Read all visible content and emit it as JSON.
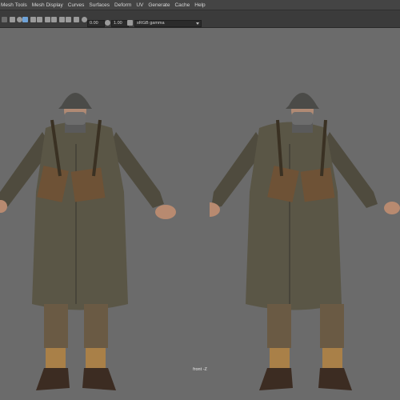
{
  "menubar": {
    "items": [
      "Mesh Tools",
      "Mesh Display",
      "Curves",
      "Surfaces",
      "Deform",
      "UV",
      "Generate",
      "Cache",
      "Help"
    ]
  },
  "toolbar": {
    "field_a": "0.00",
    "field_b": "1.00",
    "color_space": "sRGB gamma"
  },
  "viewport": {
    "camera_label": "front -Z"
  }
}
